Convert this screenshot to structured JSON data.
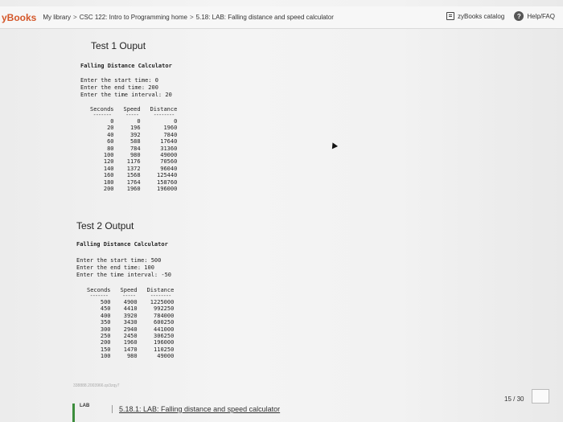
{
  "nav": {
    "logo": "yBooks",
    "crumbs": [
      "My library",
      "CSC 122: Intro to Programming home",
      "5.18: LAB: Falling distance and speed calculator"
    ],
    "catalog_label": "zyBooks catalog",
    "help_label": "Help/FAQ",
    "help_glyph": "?"
  },
  "test1": {
    "title": "Test 1 Ouput",
    "calc_title": "Falling Distance Calculator",
    "prompts": "Enter the start time: 0\nEnter the end time: 200\nEnter the time interval: 20",
    "headers": [
      "Seconds",
      "Speed",
      "Distance"
    ],
    "dashes": [
      "-------",
      "-----",
      "--------"
    ],
    "rows": [
      [
        "0",
        "0",
        "0"
      ],
      [
        "20",
        "196",
        "1960"
      ],
      [
        "40",
        "392",
        "7840"
      ],
      [
        "60",
        "588",
        "17640"
      ],
      [
        "80",
        "784",
        "31360"
      ],
      [
        "100",
        "980",
        "49000"
      ],
      [
        "120",
        "1176",
        "70560"
      ],
      [
        "140",
        "1372",
        "96040"
      ],
      [
        "160",
        "1568",
        "125440"
      ],
      [
        "180",
        "1764",
        "158760"
      ],
      [
        "200",
        "1960",
        "196000"
      ]
    ]
  },
  "test2": {
    "title": "Test 2 Output",
    "calc_title": "Falling Distance Calculator",
    "prompts": "Enter the start time: 500\nEnter the end time: 100\nEnter the time interval: -50",
    "headers": [
      "Seconds",
      "Speed",
      "Distance"
    ],
    "dashes": [
      "-------",
      "-----",
      "--------"
    ],
    "rows": [
      [
        "500",
        "4900",
        "1225000"
      ],
      [
        "450",
        "4410",
        "992250"
      ],
      [
        "400",
        "3920",
        "784000"
      ],
      [
        "350",
        "3430",
        "600250"
      ],
      [
        "300",
        "2940",
        "441000"
      ],
      [
        "250",
        "2450",
        "306250"
      ],
      [
        "200",
        "1960",
        "196000"
      ],
      [
        "150",
        "1470",
        "110250"
      ],
      [
        "100",
        "980",
        "49000"
      ]
    ]
  },
  "footer": {
    "faint_text": "338888.2003966.qx3zqy7",
    "progress": "15 / 30",
    "lab_tab": "LAB",
    "lab_link": "5.18.1: LAB: Falling distance and speed calculator"
  }
}
